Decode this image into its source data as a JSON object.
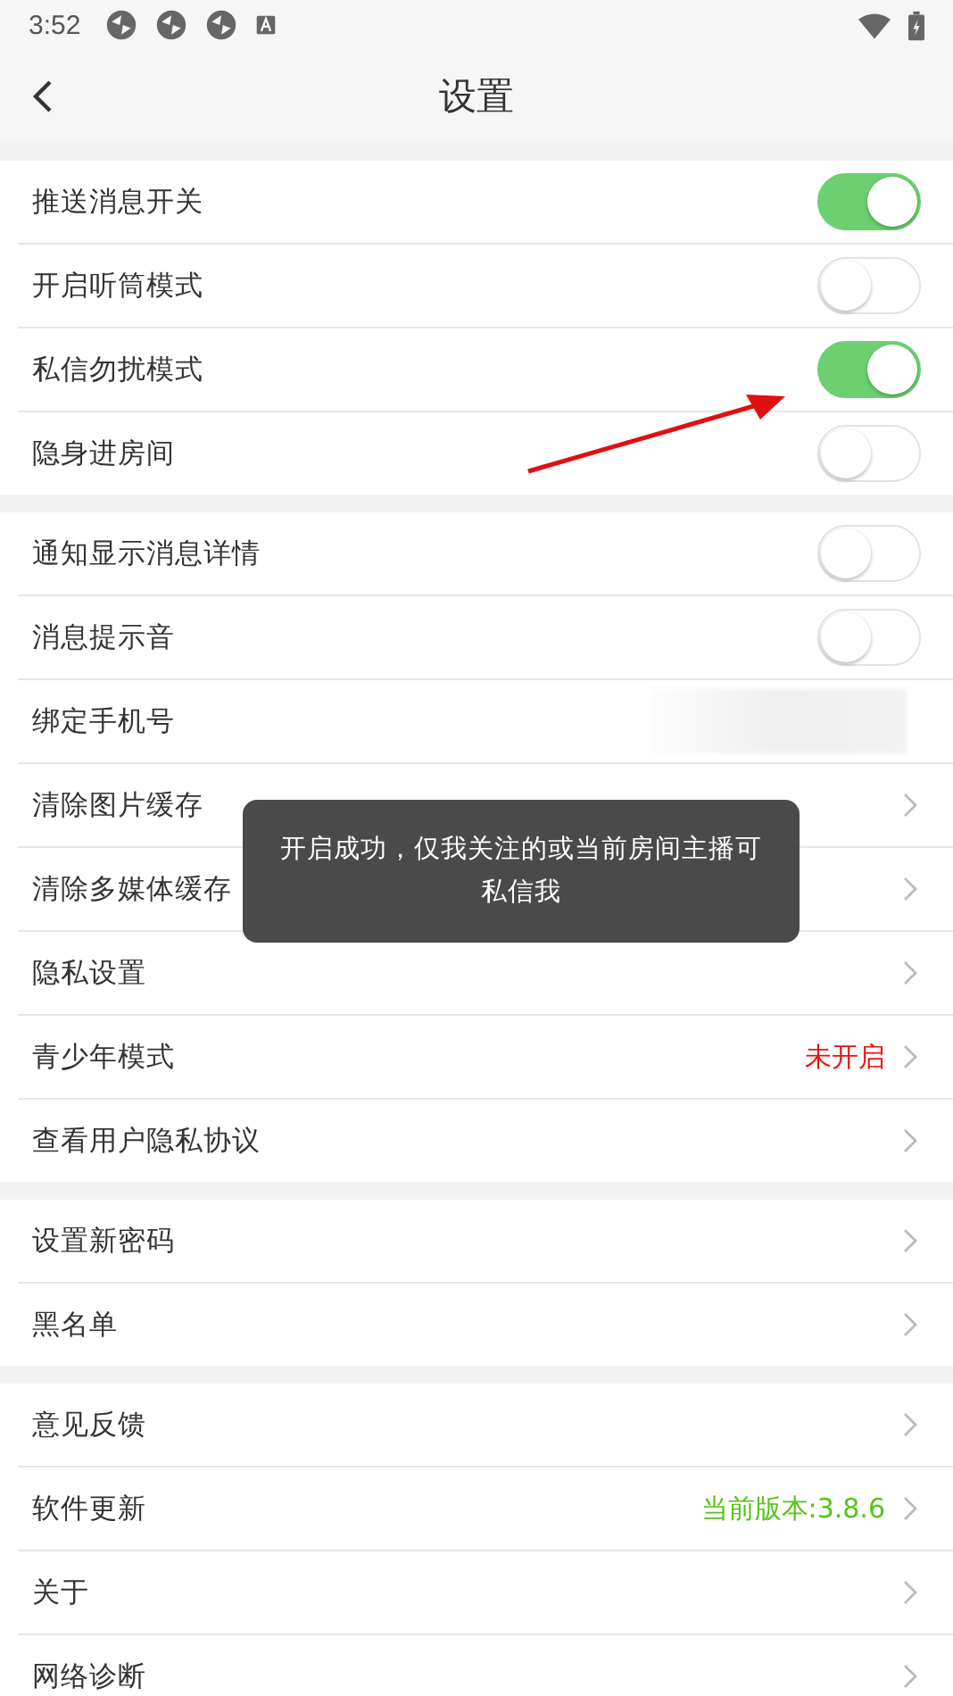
{
  "status_bar": {
    "time": "3:52"
  },
  "header": {
    "title": "设置"
  },
  "sections": [
    {
      "rows": [
        {
          "kind": "toggle",
          "label": "推送消息开关",
          "on": true
        },
        {
          "kind": "toggle",
          "label": "开启听筒模式",
          "on": false
        },
        {
          "kind": "toggle",
          "label": "私信勿扰模式",
          "on": true
        },
        {
          "kind": "toggle",
          "label": "隐身进房间",
          "on": false
        }
      ]
    },
    {
      "rows": [
        {
          "kind": "toggle",
          "label": "通知显示消息详情",
          "on": false
        },
        {
          "kind": "toggle",
          "label": "消息提示音",
          "on": false
        },
        {
          "kind": "masked",
          "label": "绑定手机号"
        },
        {
          "kind": "link",
          "label": "清除图片缓存"
        },
        {
          "kind": "link",
          "label": "清除多媒体缓存"
        },
        {
          "kind": "link",
          "label": "隐私设置"
        },
        {
          "kind": "link",
          "label": "青少年模式",
          "value": "未开启",
          "color": "#ee1111"
        },
        {
          "kind": "link",
          "label": "查看用户隐私协议"
        }
      ]
    },
    {
      "rows": [
        {
          "kind": "link",
          "label": "设置新密码"
        },
        {
          "kind": "link",
          "label": "黑名单"
        }
      ]
    },
    {
      "rows": [
        {
          "kind": "link",
          "label": "意见反馈"
        },
        {
          "kind": "link",
          "label": "软件更新",
          "value": "当前版本:3.8.6",
          "color": "#55c41a"
        },
        {
          "kind": "link",
          "label": "关于"
        },
        {
          "kind": "link",
          "label": "网络诊断"
        }
      ]
    }
  ],
  "toast": {
    "text": "开启成功，仅我关注的或当前房间主播可私信我"
  }
}
